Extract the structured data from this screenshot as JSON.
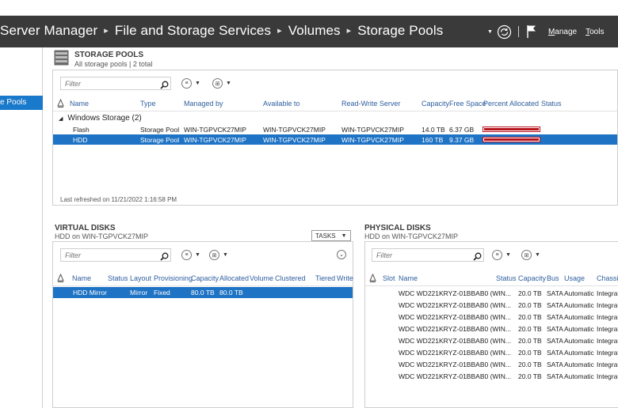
{
  "breadcrumb": [
    "Server Manager",
    "File and Storage Services",
    "Volumes",
    "Storage Pools"
  ],
  "header_menu": {
    "manage": "Manage",
    "manage_key": "M",
    "tools": "Tools",
    "tools_key": "T"
  },
  "nav": {
    "selected_item": "e Pools"
  },
  "pools": {
    "title": "STORAGE POOLS",
    "subtitle": "All storage pools | 2 total",
    "filter_placeholder": "Filter",
    "columns": [
      "Name",
      "Type",
      "Managed by",
      "Available to",
      "Read-Write Server",
      "Capacity",
      "Free Space",
      "Percent Allocated",
      "Status"
    ],
    "group_label": "Windows Storage (2)",
    "rows": [
      {
        "name": "Flash",
        "type": "Storage Pool",
        "managed_by": "WIN-TGPVCK27MIP",
        "available_to": "WIN-TGPVCK27MIP",
        "rw_server": "WIN-TGPVCK27MIP",
        "capacity": "14.0 TB",
        "free_space": "6.37 GB",
        "percent_allocated": 0.99
      },
      {
        "name": "HDD",
        "type": "Storage Pool",
        "managed_by": "WIN-TGPVCK27MIP",
        "available_to": "WIN-TGPVCK27MIP",
        "rw_server": "WIN-TGPVCK27MIP",
        "capacity": "160 TB",
        "free_space": "9.37 GB",
        "percent_allocated": 0.99
      }
    ],
    "footer": "Last refreshed on 11/21/2022 1:16:58 PM"
  },
  "virtual_disks": {
    "title": "VIRTUAL DISKS",
    "subtitle": "HDD on WIN-TGPVCK27MIP",
    "tasks_label": "TASKS",
    "filter_placeholder": "Filter",
    "columns": [
      "Name",
      "Status",
      "Layout",
      "Provisioning",
      "Capacity",
      "Allocated",
      "Volume",
      "Clustered",
      "Tiered",
      "Write"
    ],
    "rows": [
      {
        "name": "HDD Mirror",
        "status": "",
        "layout": "Mirror",
        "provisioning": "Fixed",
        "capacity": "80.0 TB",
        "allocated": "80.0 TB"
      }
    ]
  },
  "physical_disks": {
    "title": "PHYSICAL DISKS",
    "subtitle": "HDD on WIN-TGPVCK27MIP",
    "filter_placeholder": "Filter",
    "columns": [
      "Slot",
      "Name",
      "Status",
      "Capacity",
      "Bus",
      "Usage",
      "Chassis"
    ],
    "rows": [
      {
        "name": "WDC WD221KRYZ-01BBAB0 (WIN...",
        "capacity": "20.0 TB",
        "bus": "SATA",
        "usage": "Automatic",
        "chassis": "Integrated"
      },
      {
        "name": "WDC WD221KRYZ-01BBAB0 (WIN...",
        "capacity": "20.0 TB",
        "bus": "SATA",
        "usage": "Automatic",
        "chassis": "Integrated"
      },
      {
        "name": "WDC WD221KRYZ-01BBAB0 (WIN...",
        "capacity": "20.0 TB",
        "bus": "SATA",
        "usage": "Automatic",
        "chassis": "Integrated"
      },
      {
        "name": "WDC WD221KRYZ-01BBAB0 (WIN...",
        "capacity": "20.0 TB",
        "bus": "SATA",
        "usage": "Automatic",
        "chassis": "Integrated"
      },
      {
        "name": "WDC WD221KRYZ-01BBAB0 (WIN...",
        "capacity": "20.0 TB",
        "bus": "SATA",
        "usage": "Automatic",
        "chassis": "Integrated"
      },
      {
        "name": "WDC WD221KRYZ-01BBAB0 (WIN...",
        "capacity": "20.0 TB",
        "bus": "SATA",
        "usage": "Automatic",
        "chassis": "Integrated"
      },
      {
        "name": "WDC WD221KRYZ-01BBAB0 (WIN...",
        "capacity": "20.0 TB",
        "bus": "SATA",
        "usage": "Automatic",
        "chassis": "Integrated"
      },
      {
        "name": "WDC WD221KRYZ-01BBAB0 (WIN...",
        "capacity": "20.0 TB",
        "bus": "SATA",
        "usage": "Automatic",
        "chassis": "Integrated"
      }
    ]
  },
  "colors": {
    "header_bg": "#3a3a3a",
    "selection": "#1e73c4",
    "allocation_bar": "#b5121b",
    "column_header_text": "#2e5e9e"
  },
  "icons": [
    "refresh-icon",
    "flag-icon",
    "storage-pool-icon",
    "search-icon",
    "list-view-icon",
    "save-query-icon",
    "sort-icon",
    "expand-collapse-icon",
    "chevron-down-icon"
  ]
}
